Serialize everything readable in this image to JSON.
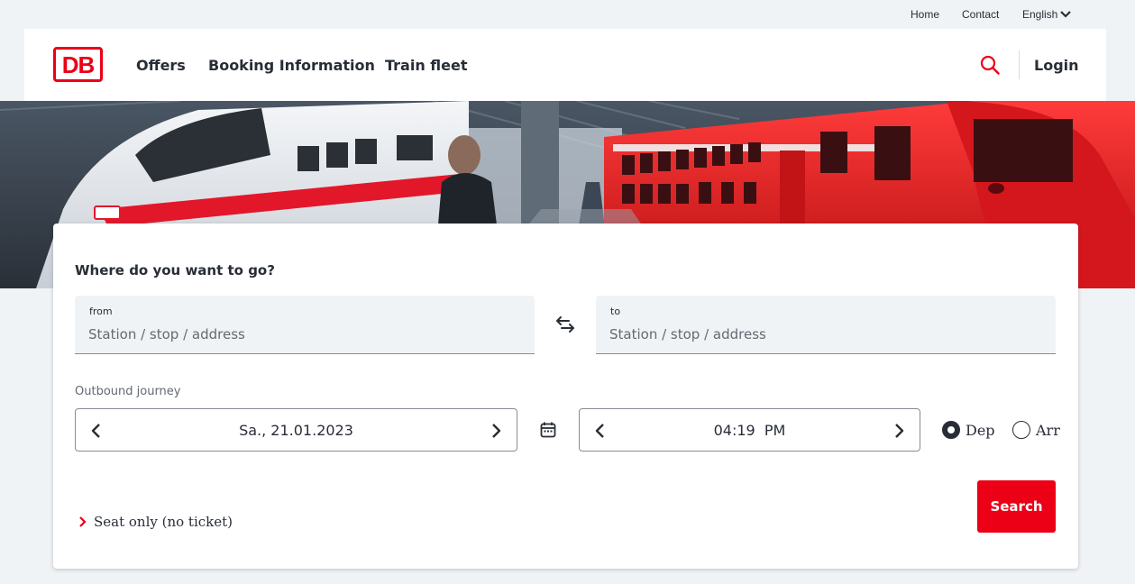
{
  "utility": {
    "home": "Home",
    "contact": "Contact",
    "language": "English"
  },
  "header": {
    "logo_text": "DB",
    "nav": [
      "Offers",
      "Booking Information",
      "Train fleet"
    ],
    "login": "Login"
  },
  "booking": {
    "title": "Where do you want to go?",
    "from_label": "from",
    "from_placeholder": "Station / stop / address",
    "to_label": "to",
    "to_placeholder": "Station / stop / address",
    "outbound_label": "Outbound journey",
    "date": "Sa., 21.01.2023",
    "time": "04:19  PM",
    "dep_label": "Dep",
    "arr_label": "Arr",
    "selected": "Dep",
    "seat_only": "Seat only (no ticket)",
    "search": "Search"
  },
  "colors": {
    "brand_red": "#ec0016",
    "text": "#282d37",
    "background": "#f0f3f5"
  }
}
